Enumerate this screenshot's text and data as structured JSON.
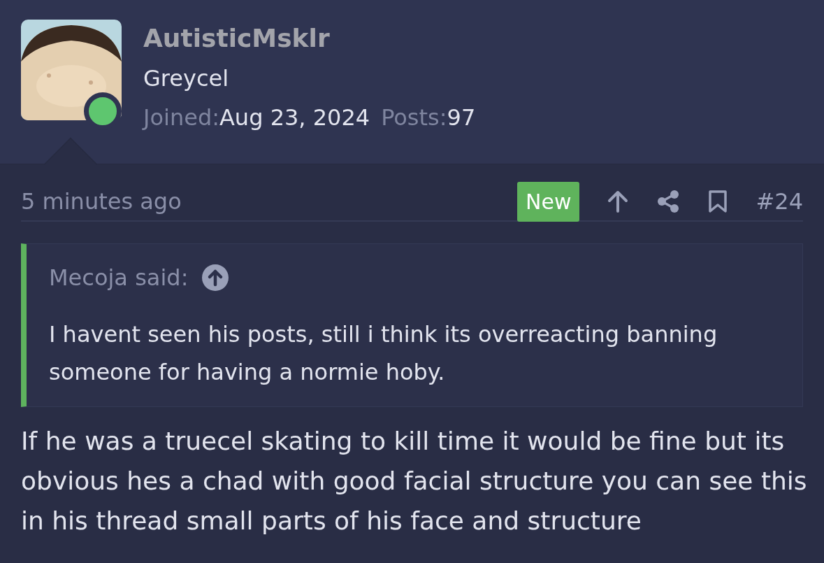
{
  "author": {
    "name": "AutisticMsklr",
    "title": "Greycel",
    "online": true,
    "joined_label": "Joined:",
    "joined": "Aug 23, 2024",
    "posts_label": "Posts:",
    "posts": "97"
  },
  "post": {
    "time": "5 minutes ago",
    "is_new": true,
    "new_label": "New",
    "number": "#24",
    "quote": {
      "author": "Mecoja said:",
      "text": "I havent seen his posts, still i think its overreacting banning someone for having a normie hoby."
    },
    "body": "If he was a truecel skating to kill time it would be fine but its obvious hes a chad with good facial structure you can see this in his thread small parts of his face and structure"
  }
}
